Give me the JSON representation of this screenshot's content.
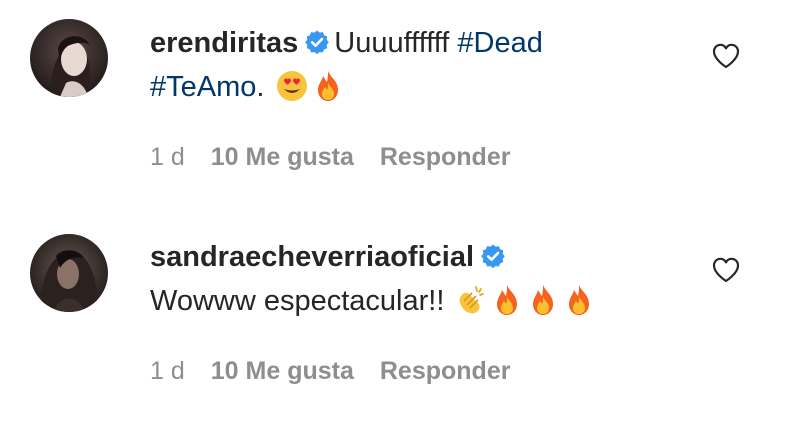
{
  "comments": [
    {
      "username": "erendiritas",
      "verified": true,
      "text_parts": {
        "lead": "Uuuuffffff ",
        "hashtag1": "#Dead",
        "hashtag2": "#TeAmo",
        "tail": ". "
      },
      "emojis": [
        "smiling-face-with-heart-eyes",
        "fire"
      ],
      "time": "1 d",
      "likes": "10 Me gusta",
      "reply": "Responder"
    },
    {
      "username": "sandraecheverriaoficial",
      "verified": true,
      "text_parts": {
        "lead": "Wowww espectacular!! "
      },
      "emojis": [
        "clapping-hands",
        "fire",
        "fire",
        "fire"
      ],
      "time": "1 d",
      "likes": "10 Me gusta",
      "reply": "Responder"
    }
  ],
  "colors": {
    "username": "#262626",
    "hashtag": "#00376b",
    "meta": "#8e8e8e",
    "verified": "#3897f0"
  }
}
